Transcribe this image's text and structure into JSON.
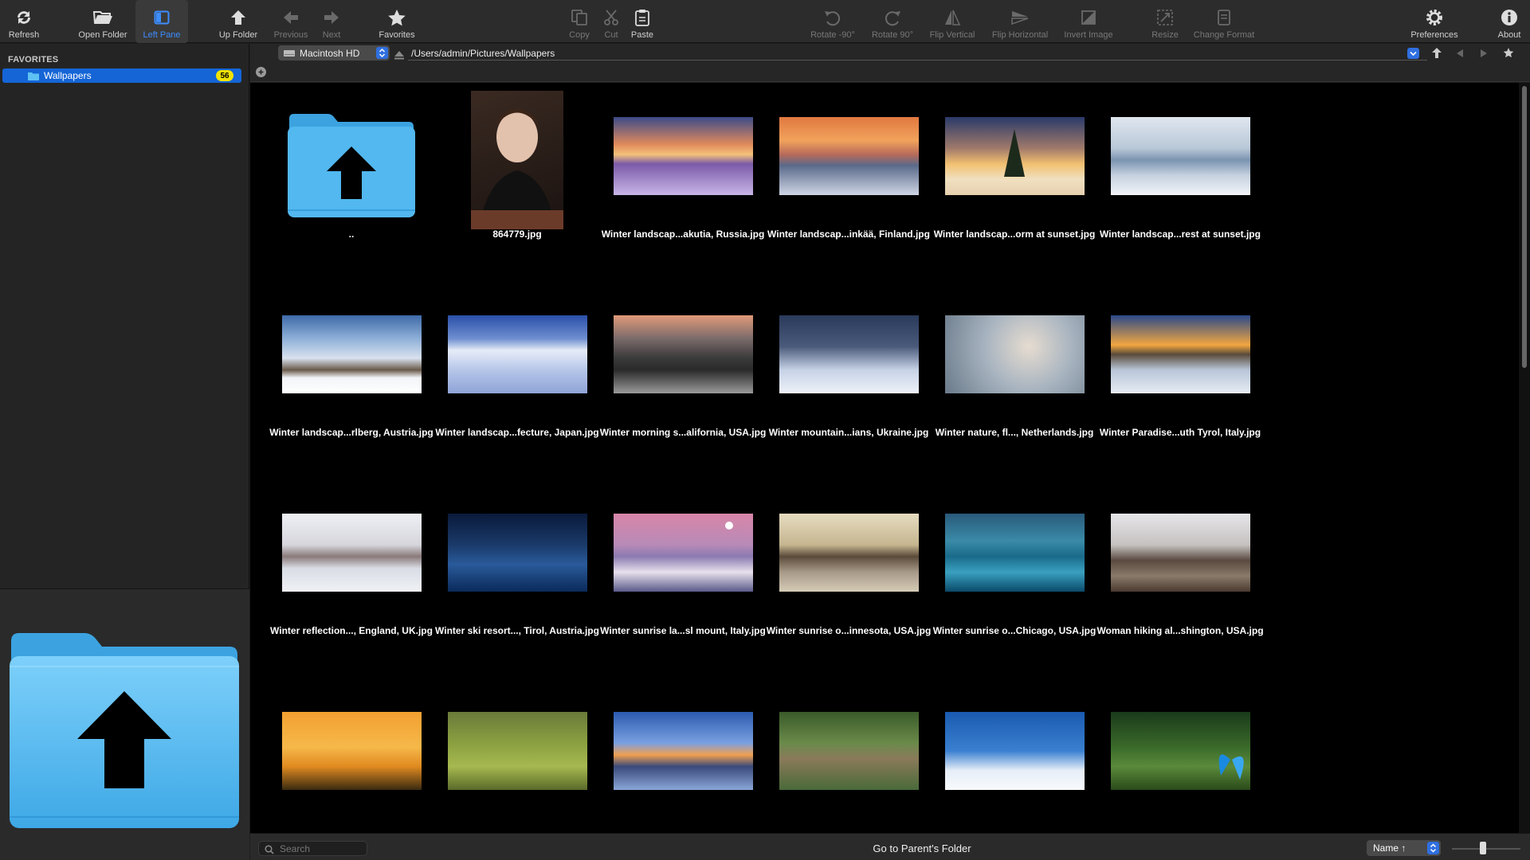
{
  "toolbar": {
    "refresh": "Refresh",
    "open_folder": "Open Folder",
    "left_pane": "Left Pane",
    "up_folder": "Up Folder",
    "previous": "Previous",
    "next": "Next",
    "favorites": "Favorites",
    "copy": "Copy",
    "cut": "Cut",
    "paste": "Paste",
    "rotate_ccw": "Rotate -90°",
    "rotate_cw": "Rotate 90°",
    "flip_vertical": "Flip Vertical",
    "flip_horizontal": "Flip Horizontal",
    "invert_image": "Invert Image",
    "resize": "Resize",
    "change_format": "Change Format",
    "preferences": "Preferences",
    "about": "About"
  },
  "sidebar": {
    "section_title": "FAVORITES",
    "items": [
      {
        "label": "Wallpapers",
        "count": "56"
      }
    ]
  },
  "pathbar": {
    "volume": "Macintosh HD",
    "path": "/Users/admin/Pictures/Wallpapers"
  },
  "files": [
    {
      "name": ".."
    },
    {
      "name": "864779.jpg"
    },
    {
      "name": "Winter landscap...akutia, Russia.jpg"
    },
    {
      "name": "Winter landscap...inkää, Finland.jpg"
    },
    {
      "name": "Winter landscap...orm at sunset.jpg"
    },
    {
      "name": "Winter landscap...rest at sunset.jpg"
    },
    {
      "name": "Winter landscap...rlberg, Austria.jpg"
    },
    {
      "name": "Winter landscap...fecture, Japan.jpg"
    },
    {
      "name": "Winter morning s...alifornia, USA.jpg"
    },
    {
      "name": "Winter mountain...ians, Ukraine.jpg"
    },
    {
      "name": "Winter nature, fl..., Netherlands.jpg"
    },
    {
      "name": "Winter Paradise...uth Tyrol, Italy.jpg"
    },
    {
      "name": "Winter reflection..., England, UK.jpg"
    },
    {
      "name": "Winter ski resort..., Tirol, Austria.jpg"
    },
    {
      "name": "Winter sunrise la...sl mount, Italy.jpg"
    },
    {
      "name": "Winter sunrise o...innesota, USA.jpg"
    },
    {
      "name": "Winter sunrise o...Chicago, USA.jpg"
    },
    {
      "name": "Woman hiking al...shington, USA.jpg"
    },
    {
      "name": ""
    },
    {
      "name": ""
    },
    {
      "name": ""
    },
    {
      "name": ""
    },
    {
      "name": ""
    },
    {
      "name": ""
    }
  ],
  "statusbar": {
    "search_placeholder": "Search",
    "status_text": "Go to Parent's Folder",
    "sort": "Name ↑"
  },
  "colors": {
    "accent": "#1565d6",
    "badge": "#f2e400",
    "folder": "#4fb6ef"
  }
}
